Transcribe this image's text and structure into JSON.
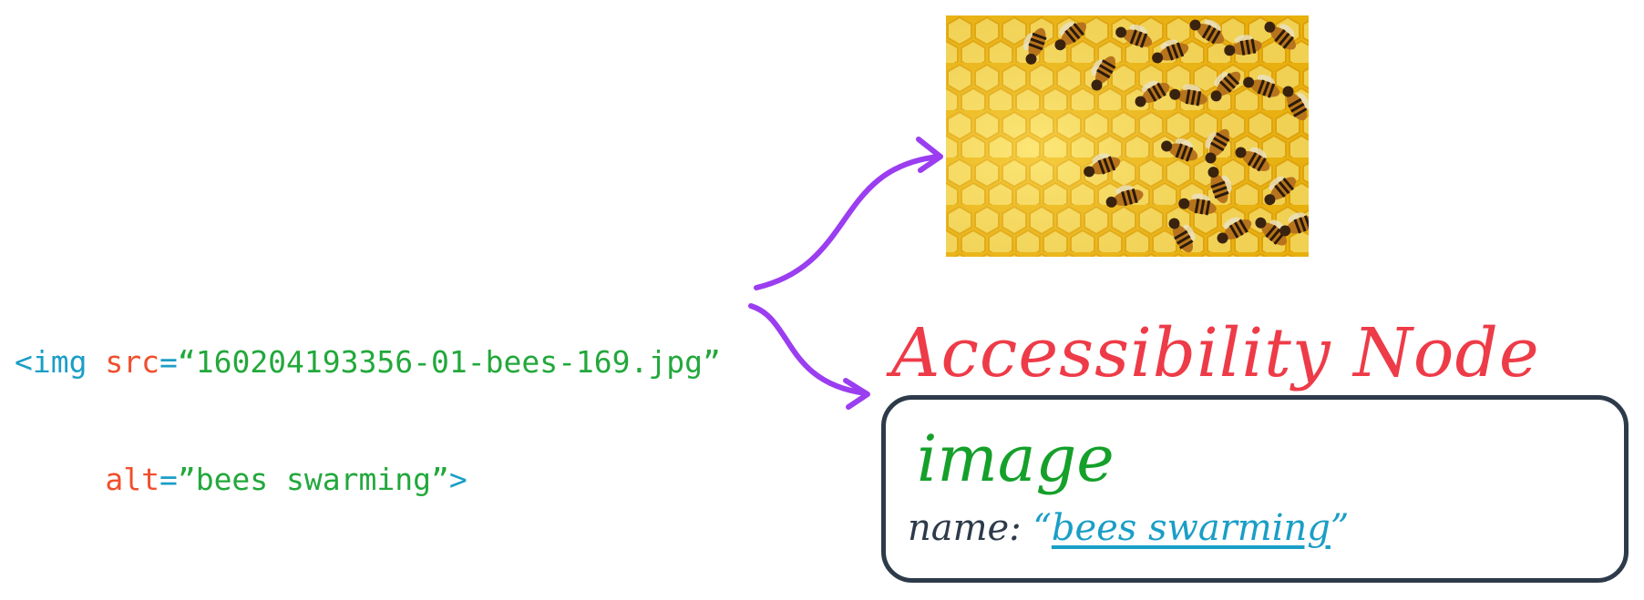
{
  "code": {
    "tag_open": "<img",
    "src_attr": "src",
    "eq": "=",
    "src_value": "“160204193356-01-bees-169.jpg”",
    "alt_attr": "alt",
    "alt_value": "”bees swarming”",
    "tag_close": ">"
  },
  "image": {
    "icon": "bees-on-honeycomb-photo"
  },
  "node": {
    "heading": "Accessibility Node",
    "role": "image",
    "name_label": "name:",
    "open_quote": "“",
    "name_value": "bees swarming",
    "close_quote": "”"
  },
  "colors": {
    "tag": "#1a9ec6",
    "attribute": "#f04f2d",
    "string": "#22a83b",
    "arrow": "#9b3df0",
    "heading": "#ee3b48",
    "role": "#15a02a",
    "box_border": "#2d3a4a"
  }
}
